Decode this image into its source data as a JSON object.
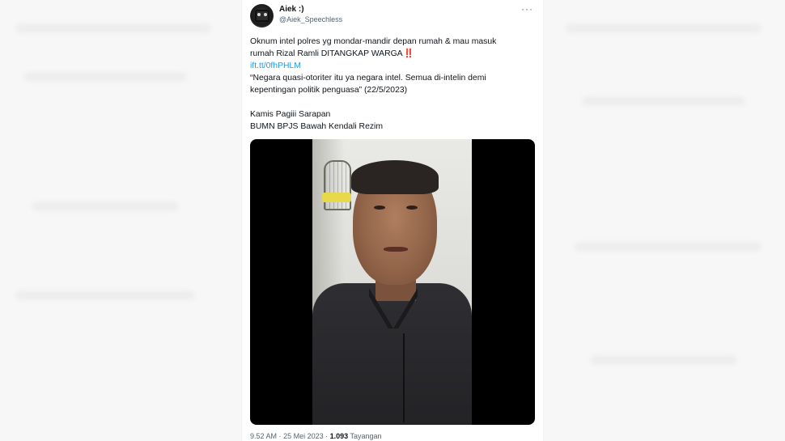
{
  "tweet": {
    "author": {
      "display_name": "Aiek :)",
      "handle": "@Aiek_Speechless",
      "avatar_icon": "cat-avatar-icon"
    },
    "more_icon": "more-options-icon",
    "text_lines": [
      "Oknum intel polres yg mondar-mandir depan rumah & mau masuk",
      "rumah Rizal Ramli DITANGKAP WARGA"
    ],
    "alert_icon": "‼️",
    "link": "ift.tt/0fhPHLM",
    "quote_lines": [
      "“Negara quasi-otoriter itu ya negara intel. Semua di-intelin demi",
      "kepentingan politik penguasa” (22/5/2023)"
    ],
    "extra_lines": [
      "Kamis Pagiii Sarapan",
      "BUMN BPJS Bawah Kendali Rezim"
    ],
    "media": {
      "type": "video",
      "icon": "video-thumbnail"
    },
    "footer": {
      "time": "9.52 AM",
      "separator": "·",
      "date": "25 Mei 2023",
      "views_count": "1.093",
      "views_label": "Tayangan"
    }
  }
}
